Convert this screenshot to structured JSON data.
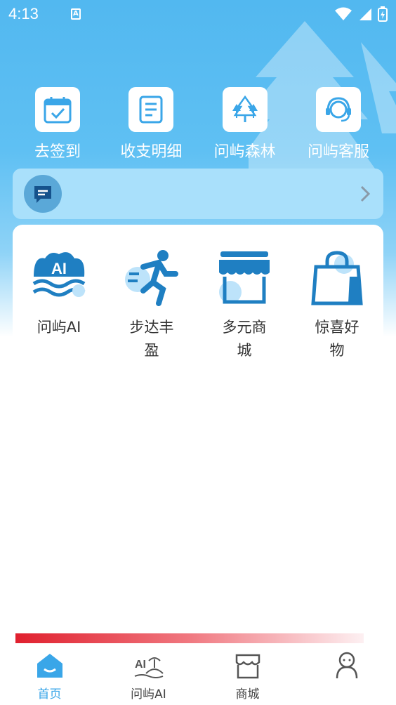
{
  "status_bar": {
    "time": "4:13",
    "notification_badge": "A"
  },
  "quick_actions": [
    {
      "label": "去签到",
      "icon": "calendar-check-icon"
    },
    {
      "label": "收支明细",
      "icon": "ledger-icon"
    },
    {
      "label": "问屿森林",
      "icon": "forest-icon"
    },
    {
      "label": "问屿客服",
      "icon": "customer-service-icon"
    }
  ],
  "notice": {
    "text": "",
    "icon": "message-icon"
  },
  "services": [
    {
      "label": "问屿AI",
      "icon": "ai-wave-icon"
    },
    {
      "label": "步达丰盈",
      "icon": "runner-icon"
    },
    {
      "label": "多元商城",
      "icon": "storefront-icon"
    },
    {
      "label": "惊喜好物",
      "icon": "shopping-bag-icon"
    }
  ],
  "tabbar": [
    {
      "label": "首页",
      "icon": "home-icon",
      "active": true
    },
    {
      "label": "问屿AI",
      "icon": "island-ai-icon",
      "active": false
    },
    {
      "label": "商城",
      "icon": "shop-icon",
      "active": false
    },
    {
      "label": "",
      "icon": "profile-icon",
      "active": false
    }
  ],
  "colors": {
    "primary": "#3aa6e8",
    "hero": "#52b8f0",
    "accent_red": "#e0202e"
  }
}
